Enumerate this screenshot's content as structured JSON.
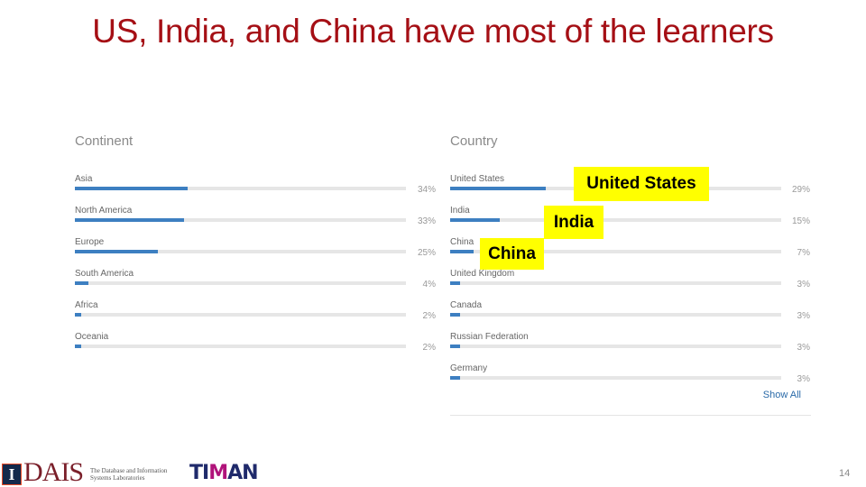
{
  "slide": {
    "title": "US, India, and China have most of the learners",
    "number": "14"
  },
  "continent": {
    "title": "Continent",
    "rows": [
      {
        "label": "Asia",
        "value": 34,
        "pct": "34%"
      },
      {
        "label": "North America",
        "value": 33,
        "pct": "33%"
      },
      {
        "label": "Europe",
        "value": 25,
        "pct": "25%"
      },
      {
        "label": "South America",
        "value": 4,
        "pct": "4%"
      },
      {
        "label": "Africa",
        "value": 2,
        "pct": "2%"
      },
      {
        "label": "Oceania",
        "value": 2,
        "pct": "2%"
      }
    ]
  },
  "country": {
    "title": "Country",
    "rows": [
      {
        "label": "United States",
        "value": 29,
        "pct": "29%"
      },
      {
        "label": "India",
        "value": 15,
        "pct": "15%"
      },
      {
        "label": "China",
        "value": 7,
        "pct": "7%"
      },
      {
        "label": "United Kingdom",
        "value": 3,
        "pct": "3%"
      },
      {
        "label": "Canada",
        "value": 3,
        "pct": "3%"
      },
      {
        "label": "Russian Federation",
        "value": 3,
        "pct": "3%"
      },
      {
        "label": "Germany",
        "value": 3,
        "pct": "3%"
      }
    ],
    "show_all": "Show All"
  },
  "callouts": {
    "us": "United States",
    "india": "India",
    "china": "China"
  },
  "colors": {
    "title": "#a50f15",
    "bar_fill": "#3d7fc1",
    "bar_track": "#e6e6e6",
    "callout_bg": "#ffff00",
    "link": "#2a6aa8"
  },
  "footer": {
    "illinois_logo": "I",
    "dais_logo": "DAIS",
    "dais_subtitle": "The Database and Information Systems Laboratories",
    "timan_logo_pre": "TI",
    "timan_logo_m": "M",
    "timan_logo_post": "AN"
  }
}
